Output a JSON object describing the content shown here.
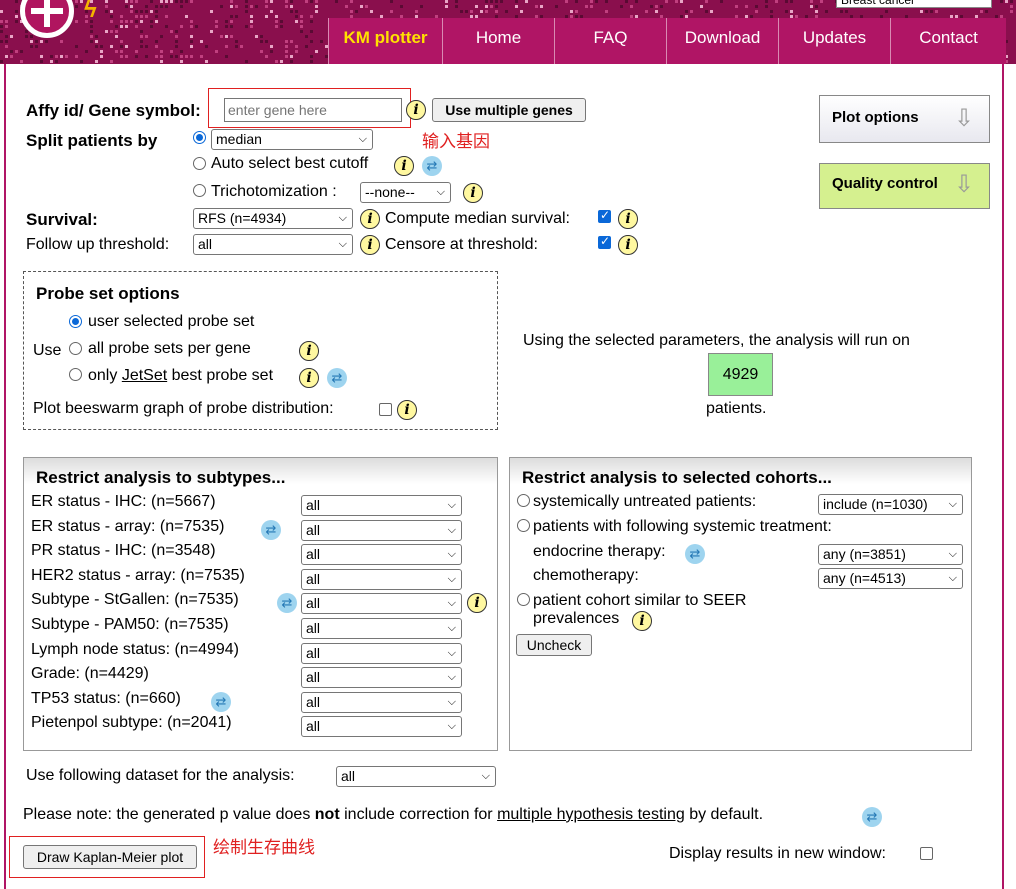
{
  "header": {
    "cancer_select": "Breast cancer",
    "nav": [
      "KM plotter",
      "Home",
      "FAQ",
      "Download",
      "Updates",
      "Contact"
    ],
    "colors": {
      "header_bg": "#8a0f4d",
      "nav_active_text": "#ffe100"
    }
  },
  "main": {
    "gene_label": "Affy id/ Gene symbol:",
    "gene_placeholder": "enter gene here",
    "multi_genes_button": "Use multiple genes",
    "gene_note": "输入基因",
    "split_label": "Split patients by",
    "split_value": "median",
    "auto_cutoff_label": "Auto select best cutoff",
    "tricho_label": "Trichotomization :",
    "tricho_value": "--none--",
    "survival_label": "Survival:",
    "survival_value": "RFS (n=4934)",
    "compute_median_label": "Compute median survival:",
    "followup_label": "Follow up threshold:",
    "followup_value": "all",
    "censore_label": "Censore at threshold:",
    "plot_options": "Plot options",
    "quality_control": "Quality control"
  },
  "probe": {
    "title": "Probe set options",
    "use_label": "Use",
    "opt_user": "user selected probe set",
    "opt_all": "all probe sets per gene",
    "opt_only_pre": "only",
    "opt_only_link": "JetSet",
    "opt_only_post": "best probe set",
    "beeswarm_label": "Plot beeswarm graph of probe distribution:"
  },
  "summary": {
    "text_pre": "Using the selected parameters, the analysis will run on",
    "count": "4929",
    "text_post": "patients."
  },
  "subtypes": {
    "title": "Restrict analysis to subtypes...",
    "rows": [
      {
        "label": "ER status - IHC: (n=5667)",
        "value": "all"
      },
      {
        "label": "ER status - array: (n=7535)",
        "value": "all"
      },
      {
        "label": "PR status - IHC: (n=3548)",
        "value": "all"
      },
      {
        "label": "HER2 status - array: (n=7535)",
        "value": "all"
      },
      {
        "label": "Subtype - StGallen: (n=7535)",
        "value": "all"
      },
      {
        "label": "Subtype - PAM50: (n=7535)",
        "value": "all"
      },
      {
        "label": "Lymph node status: (n=4994)",
        "value": "all"
      },
      {
        "label": "Grade: (n=4429)",
        "value": "all"
      },
      {
        "label": "TP53 status: (n=660)",
        "value": "all"
      },
      {
        "label": "Pietenpol subtype: (n=2041)",
        "value": "all"
      }
    ]
  },
  "cohorts": {
    "title": "Restrict analysis to selected cohorts...",
    "untreated_label": "systemically untreated patients:",
    "untreated_value": "include (n=1030)",
    "treated_label": "patients with following systemic treatment:",
    "endocrine_label": "endocrine therapy:",
    "endocrine_value": "any (n=3851)",
    "chemo_label": "chemotherapy:",
    "chemo_value": "any (n=4513)",
    "seer_label_1": "patient cohort similar to SEER",
    "seer_label_2": "prevalences",
    "uncheck_button": "Uncheck"
  },
  "footer": {
    "dataset_label": "Use following dataset for the analysis:",
    "dataset_value": "all",
    "note_pre": "Please note: the generated p value does",
    "note_bold": "not",
    "note_mid": "include correction for",
    "note_link": "multiple hypothesis testing",
    "note_post": "by default.",
    "draw_button": "Draw Kaplan-Meier plot",
    "draw_note": "绘制生存曲线",
    "new_window_label": "Display results in new window:"
  }
}
